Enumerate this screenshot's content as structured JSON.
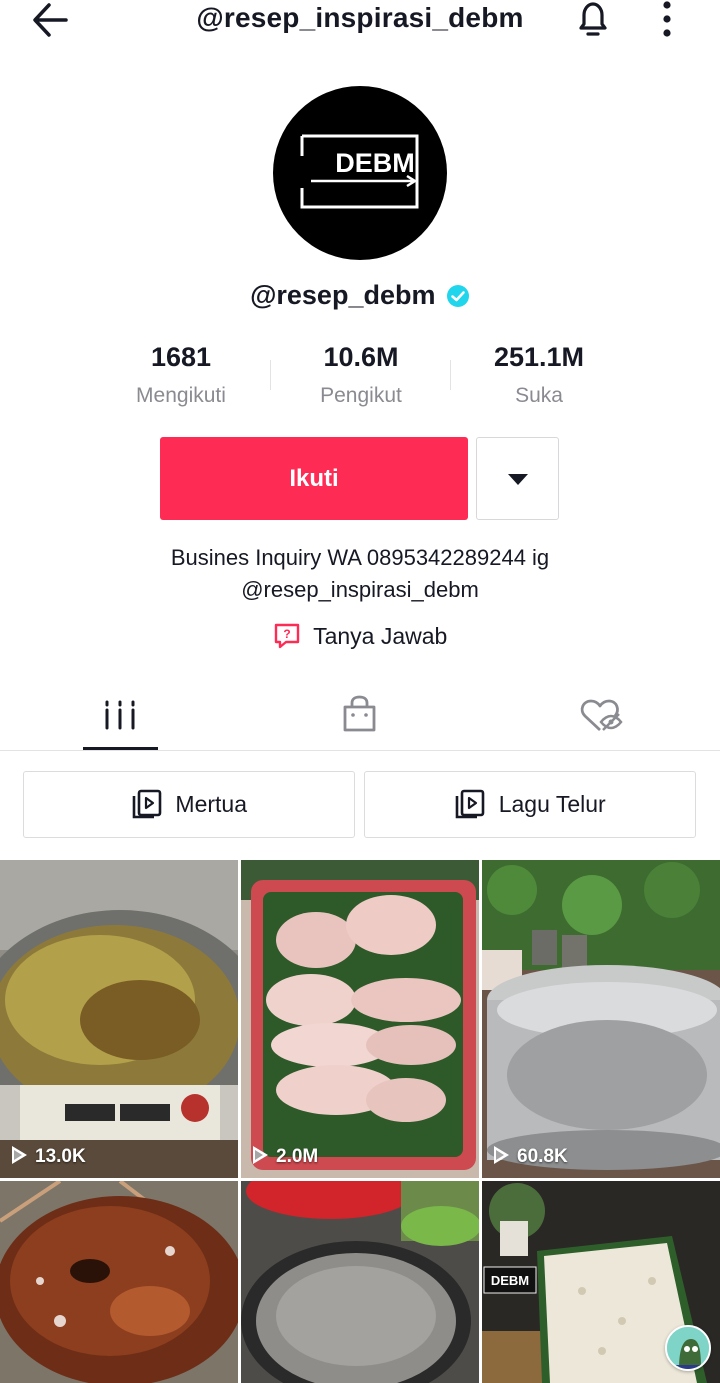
{
  "header": {
    "title": "@resep_inspirasi_debm",
    "back_icon": "arrow-left-icon",
    "bell_icon": "bell-icon",
    "more_icon": "more-vertical-icon"
  },
  "profile": {
    "avatar_text": "DEBM",
    "username": "@resep_debm",
    "verified": true,
    "verified_color": "#20d5ec"
  },
  "stats": [
    {
      "value": "1681",
      "label": "Mengikuti"
    },
    {
      "value": "10.6M",
      "label": "Pengikut"
    },
    {
      "value": "251.1M",
      "label": "Suka"
    }
  ],
  "actions": {
    "follow_label": "Ikuti",
    "follow_color": "#fe2c55",
    "dropdown_icon": "caret-down-icon"
  },
  "bio": {
    "line1": "Busines Inquiry WA 0895342289244 ig",
    "line2": "@resep_inspirasi_debm"
  },
  "qa": {
    "label": "Tanya Jawab",
    "icon": "question-bubble-icon"
  },
  "tabs": [
    {
      "icon": "videos-grid-icon",
      "active": true
    },
    {
      "icon": "shopping-bag-icon",
      "active": false
    },
    {
      "icon": "liked-hidden-icon",
      "active": false
    }
  ],
  "playlists": [
    {
      "label": "Mertua",
      "icon": "playlist-icon"
    },
    {
      "label": "Lagu Telur",
      "icon": "playlist-icon"
    }
  ],
  "videos": [
    {
      "views": "13.0K",
      "subject": "oil-in-wok"
    },
    {
      "views": "2.0M",
      "subject": "raw-chicken-wings"
    },
    {
      "views": "60.8K",
      "subject": "water-in-pot"
    },
    {
      "views": "",
      "subject": "brown-sugar-cake"
    },
    {
      "views": "",
      "subject": "griddle-pan"
    },
    {
      "views": "",
      "subject": "tempeh-block"
    }
  ]
}
